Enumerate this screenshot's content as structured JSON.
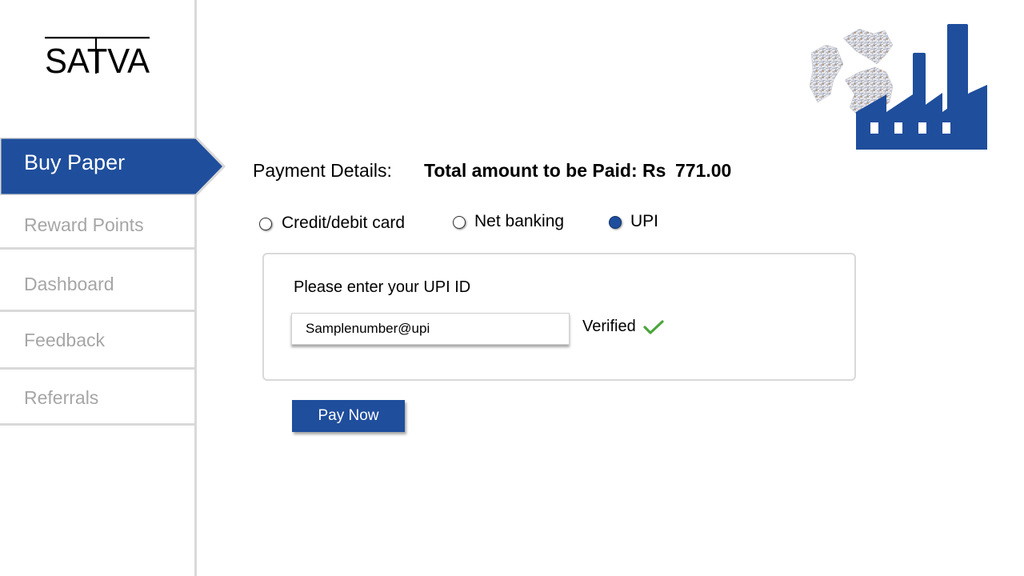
{
  "brand": {
    "name": "SATVA"
  },
  "sidebar": {
    "active_item": "Buy Paper",
    "items": [
      {
        "label": "Reward Points"
      },
      {
        "label": "Dashboard"
      },
      {
        "label": "Feedback"
      },
      {
        "label": "Referrals"
      }
    ]
  },
  "payment": {
    "label": "Payment Details:",
    "total_label": "Total amount to be Paid: Rs",
    "total_amount": "771.00",
    "methods": [
      {
        "label": "Credit/debit card",
        "selected": false
      },
      {
        "label": "Net banking",
        "selected": false
      },
      {
        "label": "UPI",
        "selected": true
      }
    ]
  },
  "upi": {
    "prompt": "Please enter your UPI ID",
    "value": "Samplenumber@upi",
    "status": "Verified"
  },
  "actions": {
    "pay_label": "Pay Now"
  },
  "icons": {
    "brand_logo": "satva-logo-icon",
    "recycle_factory": "recycle-factory-icon",
    "verified": "check-icon"
  },
  "colors": {
    "accent": "#1f4e9c",
    "muted_text": "#a6a6a6",
    "divider": "#d9d9d9",
    "verified": "#4aa53a"
  }
}
